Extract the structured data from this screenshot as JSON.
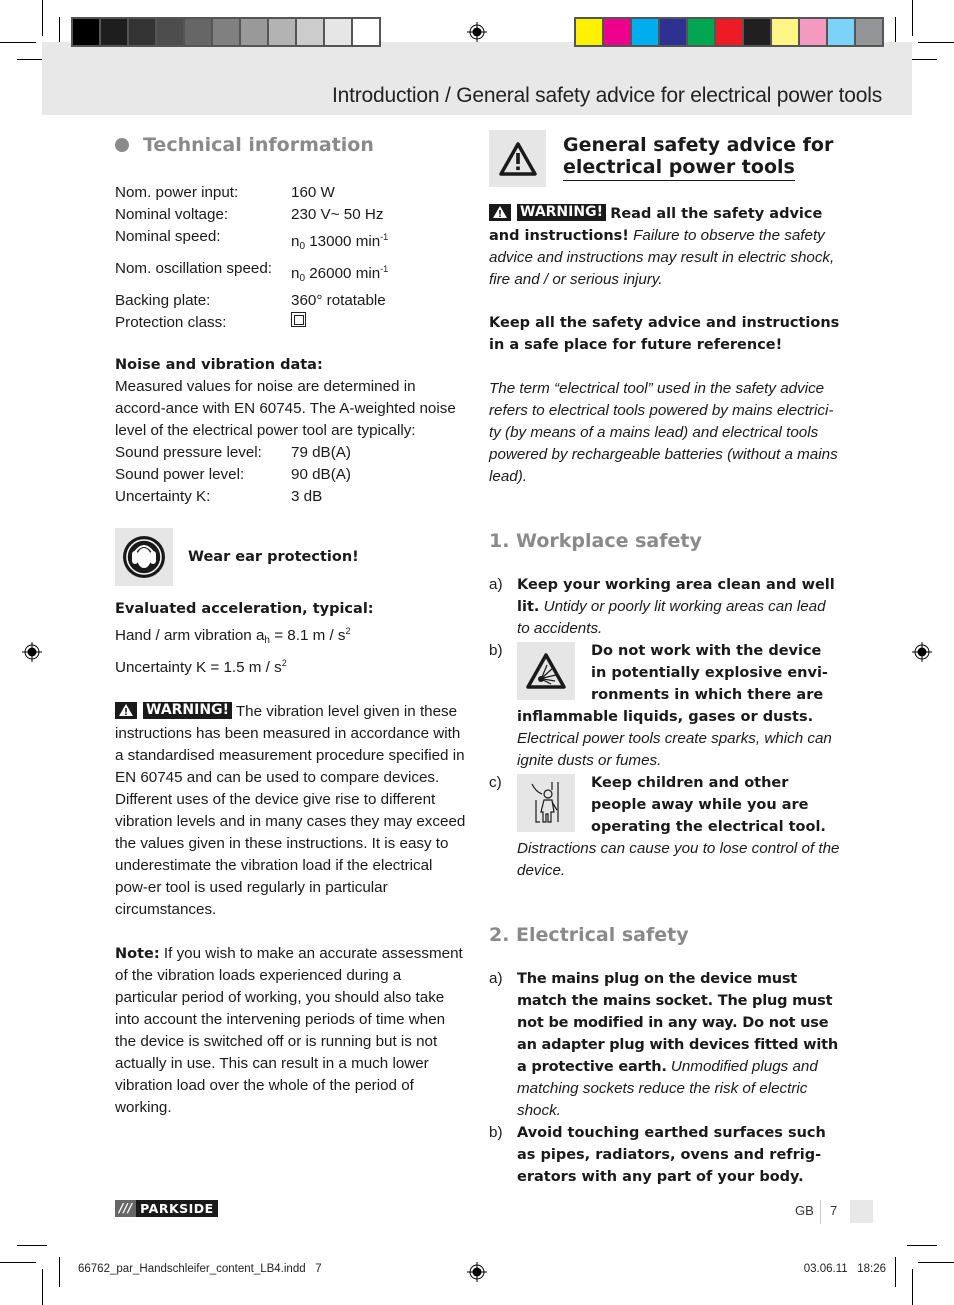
{
  "print_marks": {
    "grayscale_swatches": [
      "#000000",
      "#1e1e1e",
      "#333333",
      "#4d4d4d",
      "#666666",
      "#808080",
      "#999999",
      "#b3b3b3",
      "#cccccc",
      "#e6e6e6",
      "#ffffff"
    ],
    "color_swatches": [
      "#fff200",
      "#ec008c",
      "#00aeef",
      "#2e3192",
      "#00a651",
      "#ed1c24",
      "#231f20",
      "#fff685",
      "#f49ac1",
      "#7dd3f7",
      "#939598"
    ]
  },
  "header": {
    "title": "Introduction / General safety advice for electrical power tools"
  },
  "technical_information": {
    "heading": "Technical information",
    "specs": [
      {
        "label": "Nom. power input:",
        "value": "160 W"
      },
      {
        "label": "Nominal voltage:",
        "value": "230 V~ 50 Hz"
      },
      {
        "label": "Nominal speed:",
        "prefix": "n",
        "sub": "0",
        "value": " 13000 min",
        "sup": "-1"
      },
      {
        "label": "Nom. oscillation speed:",
        "prefix": "n",
        "sub": "0",
        "value": " 26000 min",
        "sup": "-1"
      },
      {
        "label": "Backing plate:",
        "value": "360° rotatable"
      },
      {
        "label": "Protection class:",
        "value_icon": "protection-class-ii-icon"
      }
    ],
    "noise": {
      "heading": "Noise and vibration data:",
      "intro": "Measured values for noise are determined in accord-ance with EN 60745. The A-weighted noise level of the electrical power tool are typically:",
      "rows": [
        {
          "label": "Sound pressure level:",
          "value": "79 dB(A)"
        },
        {
          "label": "Sound power level:",
          "value": "90 dB(A)"
        },
        {
          "label": "Uncertainty K:",
          "value": "3 dB"
        }
      ]
    },
    "ear_protection": "Wear ear protection!",
    "acceleration": {
      "heading": "Evaluated acceleration, typical:",
      "line1_pre": "Hand / arm vibration a",
      "line1_sub": "h",
      "line1_post": " = 8.1 m / s",
      "line1_sup": "2",
      "line2_pre": "Uncertainty K = 1.5 m / s",
      "line2_sup": "2"
    },
    "warning": {
      "badge": "WARNING!",
      "text": "The vibration level given in these instructions has been measured in accordance with a standardised measurement procedure specified in EN 60745 and can be used to compare devices. Different uses of the device give rise to different vibration levels and in many cases they may exceed the values given in these instructions. It is easy to underestimate the vibration load if the electrical pow-er tool is used regularly in particular circumstances."
    },
    "note": {
      "label": "Note:",
      "text": "If you wish to make an accurate assessment of the vibration loads experienced during a particular period of working, you should also take into account the intervening periods of time when the device is switched off or is running but is not actually in use. This can result in a much lower vibration load over the whole of the period of working."
    }
  },
  "general_safety": {
    "heading_line1": "General safety advice for",
    "heading_line2": "electrical power tools",
    "warning_badge": "WARNING!",
    "warning_bold": "Read all the safety advice and instructions!",
    "warning_italic": "Failure to observe the safety advice and instructions may result in electric shock, fire and / or serious injury.",
    "keep_bold": "Keep all the safety advice and instructions in a safe place for future reference!",
    "term_italic": "The term “electrical tool” used in the safety advice refers to electrical tools powered by mains electrici-ty (by means of a mains lead) and electrical tools powered by rechargeable batteries (without a mains lead).",
    "workplace": {
      "heading": "1. Workplace safety",
      "items": [
        {
          "letter": "a)",
          "bold": "Keep your working area clean and well lit.",
          "italic": "Untidy or poorly lit working areas can lead to accidents."
        },
        {
          "letter": "b)",
          "bold": "Do not work with the device in potentially explosive envi-ronments in which there are inflammable liquids, gases or dusts.",
          "italic": "Electrical power tools create sparks, which can ignite dusts or fumes."
        },
        {
          "letter": "c)",
          "bold": "Keep children and other people away while you are operating the electrical tool.",
          "italic": "Distractions can cause you to lose control of the device."
        }
      ]
    },
    "electrical": {
      "heading": "2. Electrical safety",
      "items": [
        {
          "letter": "a)",
          "bold": "The mains plug on the device must match the mains socket. The plug must not be modified in any way. Do not use an adapter plug with devices fitted with a protective earth.",
          "italic": "Unmodified plugs and matching sockets reduce the risk of electric shock."
        },
        {
          "letter": "b)",
          "bold": "Avoid touching earthed surfaces such as pipes, radiators, ovens and refrig-erators with any part of your body.",
          "italic": ""
        }
      ]
    }
  },
  "footer": {
    "logo_slashes": "///",
    "logo_name": "PARKSIDE",
    "country": "GB",
    "page_number": "7",
    "slug_file": "66762_par_Handschleifer_content_LB4.indd   7",
    "slug_date": "03.06.11   18:26"
  }
}
